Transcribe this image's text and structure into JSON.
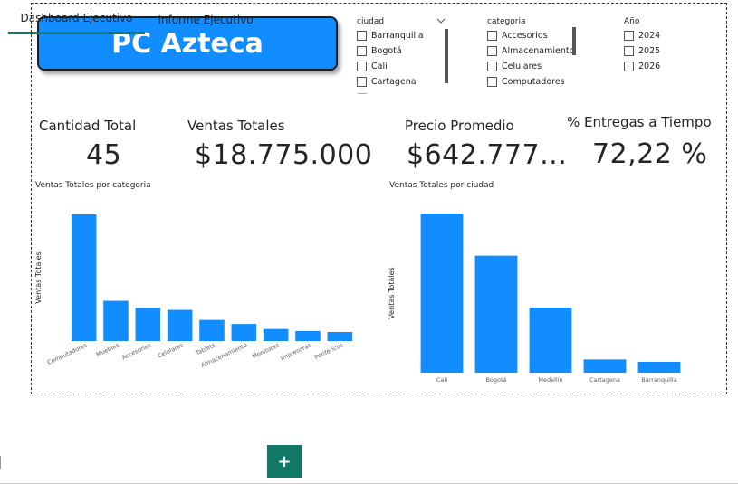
{
  "title": "PC Azteca",
  "slicers": {
    "ciudad": {
      "label": "ciudad",
      "items": [
        "Barranquilla",
        "Bogotá",
        "Cali",
        "Cartagena"
      ]
    },
    "categoria": {
      "label": "categoria",
      "items": [
        "Accesorios",
        "Almacenamiento",
        "Celulares",
        "Computadores"
      ]
    },
    "anio": {
      "label": "Año",
      "items": [
        "2024",
        "2025",
        "2026"
      ]
    }
  },
  "kpis": {
    "cantidad": {
      "label": "Cantidad Total",
      "value": "45"
    },
    "ventas": {
      "label": "Ventas Totales",
      "value": "$18.775.000"
    },
    "precio": {
      "label": "Precio Promedio",
      "value": "$642.777..."
    },
    "entregas": {
      "label": "% Entregas a Tiempo",
      "value": "72,22 %"
    }
  },
  "chart_data": [
    {
      "type": "bar",
      "title": "Ventas Totales por categoria",
      "xlabel": "",
      "ylabel": "Ventas Totales",
      "categories": [
        "Computadores",
        "Muebles",
        "Accesorios",
        "Celulares",
        "Tablets",
        "Almacenamiento",
        "Monitores",
        "Impresoras",
        "Periféricos"
      ],
      "values": [
        6.3,
        2.0,
        1.65,
        1.55,
        1.05,
        0.85,
        0.6,
        0.5,
        0.45
      ],
      "color": "#118dff"
    },
    {
      "type": "bar",
      "title": "Ventas Totales por ciudad",
      "xlabel": "",
      "ylabel": "Ventas Totales",
      "categories": [
        "Cali",
        "Bogotá",
        "Medellín",
        "Cartagena",
        "Barranquilla"
      ],
      "values": [
        6.6,
        4.85,
        2.7,
        0.55,
        0.45
      ],
      "color": "#118dff"
    }
  ],
  "tabs": [
    {
      "label": "Dashboard Ejecutivo",
      "active": true
    },
    {
      "label": "Informe Ejecutivo",
      "active": false
    }
  ],
  "add_tab_label": "+"
}
